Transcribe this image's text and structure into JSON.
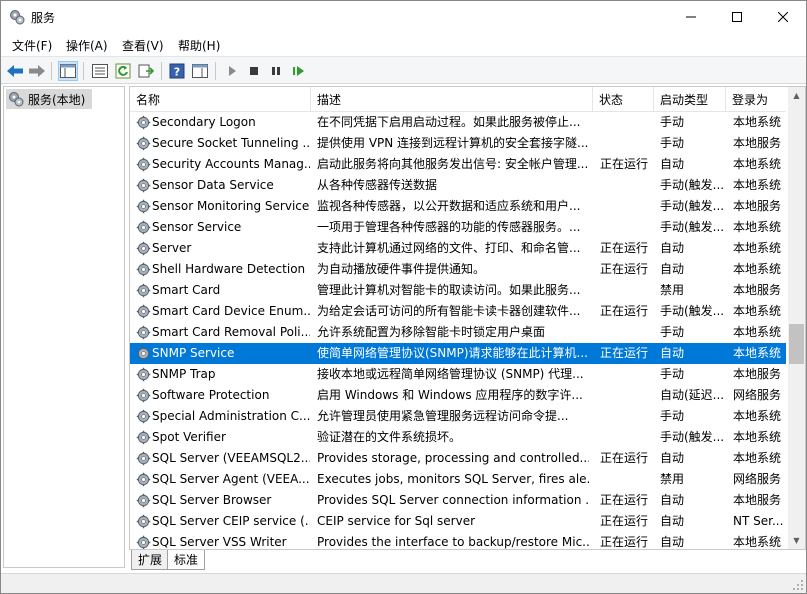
{
  "window": {
    "title": "服务"
  },
  "menu": [
    "文件(F)",
    "操作(A)",
    "查看(V)",
    "帮助(H)"
  ],
  "tree": {
    "root_label": "服务(本地)"
  },
  "columns": {
    "name": "名称",
    "desc": "描述",
    "status": "状态",
    "start": "启动类型",
    "logon": "登录为"
  },
  "services": [
    {
      "name": "Secondary Logon",
      "desc": "在不同凭据下启用启动过程。如果此服务被停止...",
      "status": "",
      "start": "手动",
      "logon": "本地系统"
    },
    {
      "name": "Secure Socket Tunneling ...",
      "desc": "提供使用 VPN 连接到远程计算机的安全套接字隧...",
      "status": "",
      "start": "手动",
      "logon": "本地服务"
    },
    {
      "name": "Security Accounts Manag...",
      "desc": "启动此服务将向其他服务发出信号: 安全帐户管理...",
      "status": "正在运行",
      "start": "自动",
      "logon": "本地系统"
    },
    {
      "name": "Sensor Data Service",
      "desc": "从各种传感器传送数据",
      "status": "",
      "start": "手动(触发...",
      "logon": "本地系统"
    },
    {
      "name": "Sensor Monitoring Service",
      "desc": "监视各种传感器，以公开数据和适应系统和用户...",
      "status": "",
      "start": "手动(触发...",
      "logon": "本地服务"
    },
    {
      "name": "Sensor Service",
      "desc": "一项用于管理各种传感器的功能的传感器服务。...",
      "status": "",
      "start": "手动(触发...",
      "logon": "本地系统"
    },
    {
      "name": "Server",
      "desc": "支持此计算机通过网络的文件、打印、和命名管...",
      "status": "正在运行",
      "start": "自动",
      "logon": "本地系统"
    },
    {
      "name": "Shell Hardware Detection",
      "desc": "为自动播放硬件事件提供通知。",
      "status": "正在运行",
      "start": "自动",
      "logon": "本地系统"
    },
    {
      "name": "Smart Card",
      "desc": "管理此计算机对智能卡的取读访问。如果此服务...",
      "status": "",
      "start": "禁用",
      "logon": "本地服务"
    },
    {
      "name": "Smart Card Device Enum...",
      "desc": "为给定会话可访问的所有智能卡读卡器创建软件...",
      "status": "正在运行",
      "start": "手动(触发...",
      "logon": "本地系统"
    },
    {
      "name": "Smart Card Removal Poli...",
      "desc": "允许系统配置为移除智能卡时锁定用户桌面",
      "status": "",
      "start": "手动",
      "logon": "本地系统"
    },
    {
      "name": "SNMP Service",
      "desc": "使简单网络管理协议(SNMP)请求能够在此计算机...",
      "status": "正在运行",
      "start": "自动",
      "logon": "本地系统",
      "selected": true
    },
    {
      "name": "SNMP Trap",
      "desc": "接收本地或远程简单网络管理协议 (SNMP) 代理...",
      "status": "",
      "start": "手动",
      "logon": "本地服务"
    },
    {
      "name": "Software Protection",
      "desc": "启用 Windows 和 Windows 应用程序的数字许...",
      "status": "",
      "start": "自动(延迟...",
      "logon": "网络服务"
    },
    {
      "name": "Special Administration C...",
      "desc": "允许管理员使用紧急管理服务远程访问命令提...",
      "status": "",
      "start": "手动",
      "logon": "本地系统"
    },
    {
      "name": "Spot Verifier",
      "desc": "验证潜在的文件系统损坏。",
      "status": "",
      "start": "手动(触发...",
      "logon": "本地系统"
    },
    {
      "name": "SQL Server (VEEAMSQL2...",
      "desc": "Provides storage, processing and controlled...",
      "status": "正在运行",
      "start": "自动",
      "logon": "本地系统"
    },
    {
      "name": "SQL Server Agent (VEEA...",
      "desc": "Executes jobs, monitors SQL Server, fires ale...",
      "status": "",
      "start": "禁用",
      "logon": "网络服务"
    },
    {
      "name": "SQL Server Browser",
      "desc": "Provides SQL Server connection information ...",
      "status": "正在运行",
      "start": "自动",
      "logon": "本地服务"
    },
    {
      "name": "SQL Server CEIP service (...",
      "desc": "CEIP service for Sql server",
      "status": "正在运行",
      "start": "自动",
      "logon": "NT Ser..."
    },
    {
      "name": "SQL Server VSS Writer",
      "desc": "Provides the interface to backup/restore Mic...",
      "status": "正在运行",
      "start": "自动",
      "logon": "本地系统"
    }
  ],
  "tabs": [
    "扩展",
    "标准"
  ],
  "colors": {
    "selection": "#0078d7",
    "nav_arrow": "#1e73be"
  },
  "icons": {
    "title": "services-app-icon",
    "back": "back-arrow-icon",
    "forward": "forward-arrow-icon",
    "row": "gear-icon"
  }
}
